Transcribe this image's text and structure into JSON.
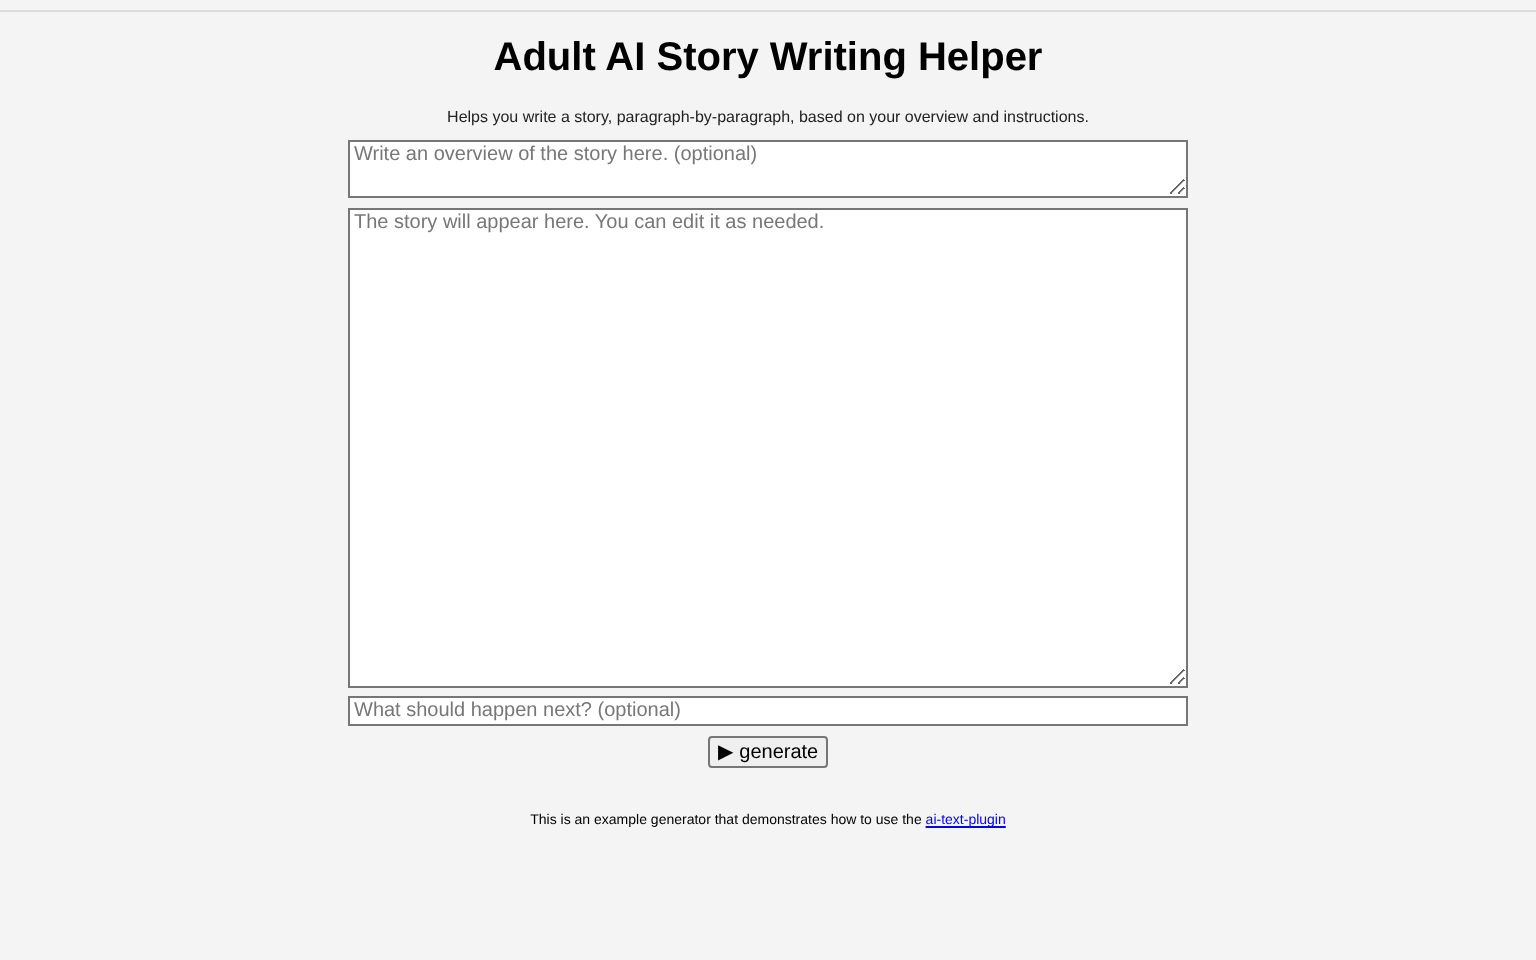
{
  "title": "Adult AI Story Writing Helper",
  "subtitle": "Helps you write a story, paragraph-by-paragraph, based on your overview and instructions.",
  "overview_field": {
    "placeholder": "Write an overview of the story here. (optional)"
  },
  "story_field": {
    "placeholder": "The story will appear here. You can edit it as needed."
  },
  "next_field": {
    "placeholder": "What should happen next? (optional)"
  },
  "generate_button": "▶ generate",
  "footer": {
    "text": "This is an example generator that demonstrates how to use the ",
    "link": "ai-text-plugin"
  }
}
